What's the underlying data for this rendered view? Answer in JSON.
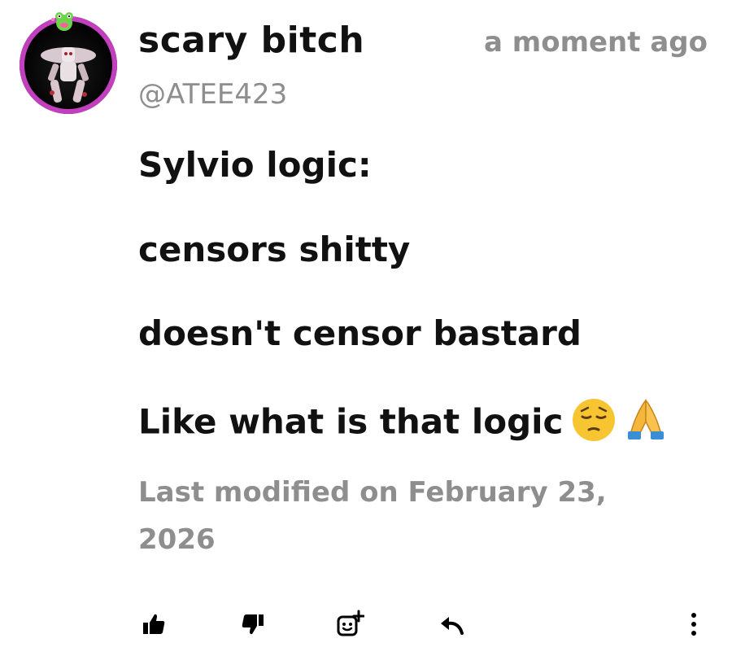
{
  "comment": {
    "author_name": "scary bitch",
    "timestamp": "a moment ago",
    "handle": "@ATEE423",
    "lines": [
      "Sylvio logic:",
      "censors shitty",
      "doesn't censor bastard",
      "Like what is that logic"
    ],
    "emojis": [
      "pensive-face",
      "folded-hands"
    ],
    "modified_text": "Last modified on February 23, 2026"
  },
  "avatar": {
    "ring_color": "#c23fbe",
    "badge": "frog-face"
  },
  "actions": [
    {
      "name": "like",
      "icon": "thumbs-up-icon"
    },
    {
      "name": "dislike",
      "icon": "thumbs-down-icon"
    },
    {
      "name": "react",
      "icon": "add-reaction-icon"
    },
    {
      "name": "reply",
      "icon": "reply-icon"
    },
    {
      "name": "more",
      "icon": "more-vertical-icon"
    }
  ]
}
